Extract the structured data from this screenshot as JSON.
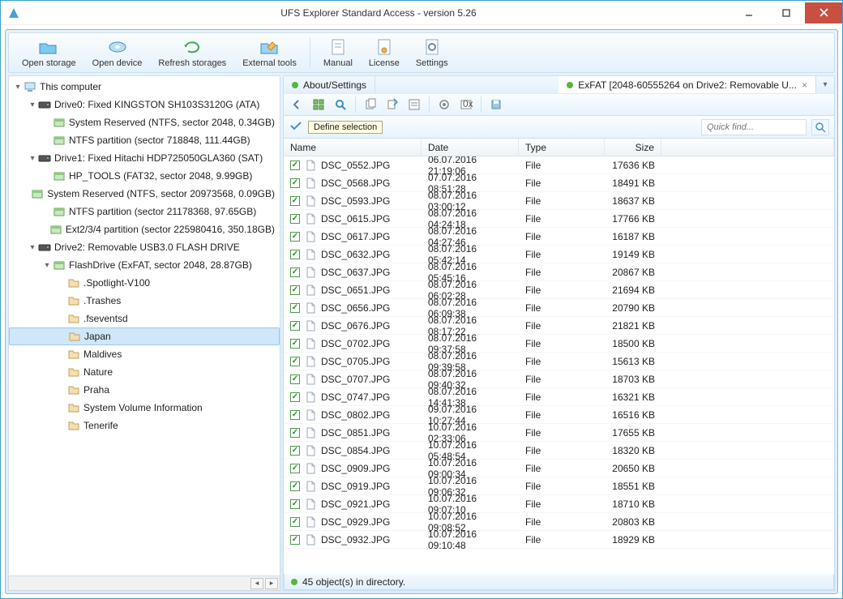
{
  "window": {
    "title": "UFS Explorer Standard Access - version 5.26"
  },
  "toolbar": {
    "open_storage": "Open storage",
    "open_device": "Open device",
    "refresh_storages": "Refresh storages",
    "external_tools": "External tools",
    "manual": "Manual",
    "license": "License",
    "settings": "Settings"
  },
  "tree": {
    "root": "This computer",
    "drives": [
      {
        "label": "Drive0: Fixed KINGSTON SH103S3120G (ATA)",
        "parts": [
          "System Reserved (NTFS, sector 2048, 0.34GB)",
          "NTFS partition (sector 718848, 111.44GB)"
        ]
      },
      {
        "label": "Drive1: Fixed Hitachi HDP725050GLA360 (SAT)",
        "parts": [
          "HP_TOOLS (FAT32, sector 2048, 9.99GB)",
          "System Reserved (NTFS, sector 20973568, 0.09GB)",
          "NTFS partition (sector 21178368, 97.65GB)",
          "Ext2/3/4 partition (sector 225980416, 350.18GB)"
        ]
      },
      {
        "label": "Drive2: Removable USB3.0 FLASH DRIVE",
        "parts": [
          "FlashDrive (ExFAT, sector 2048, 28.87GB)"
        ],
        "folders": [
          ".Spotlight-V100",
          ".Trashes",
          ".fseventsd",
          "Japan",
          "Maldives",
          "Nature",
          "Praha",
          "System Volume Information",
          "Tenerife"
        ],
        "selected_folder": "Japan"
      }
    ]
  },
  "tabs": {
    "about": "About/Settings",
    "exfat": "ExFAT [2048-60555264 on Drive2: Removable U..."
  },
  "define_tooltip": "Define selection",
  "search": {
    "placeholder": "Quick find..."
  },
  "columns": {
    "name": "Name",
    "date": "Date",
    "type": "Type",
    "size": "Size"
  },
  "files": [
    {
      "name": "DSC_0552.JPG",
      "date": "06.07.2016 21:19:06",
      "type": "File",
      "size": "17636 KB"
    },
    {
      "name": "DSC_0568.JPG",
      "date": "07.07.2016 08:51:28",
      "type": "File",
      "size": "18491 KB"
    },
    {
      "name": "DSC_0593.JPG",
      "date": "08.07.2016 03:00:12",
      "type": "File",
      "size": "18637 KB"
    },
    {
      "name": "DSC_0615.JPG",
      "date": "08.07.2016 04:24:18",
      "type": "File",
      "size": "17766 KB"
    },
    {
      "name": "DSC_0617.JPG",
      "date": "08.07.2016 04:27:46",
      "type": "File",
      "size": "16187 KB"
    },
    {
      "name": "DSC_0632.JPG",
      "date": "08.07.2016 05:42:14",
      "type": "File",
      "size": "19149 KB"
    },
    {
      "name": "DSC_0637.JPG",
      "date": "08.07.2016 05:45:16",
      "type": "File",
      "size": "20867 KB"
    },
    {
      "name": "DSC_0651.JPG",
      "date": "08.07.2016 06:02:28",
      "type": "File",
      "size": "21694 KB"
    },
    {
      "name": "DSC_0656.JPG",
      "date": "08.07.2016 06:09:38",
      "type": "File",
      "size": "20790 KB"
    },
    {
      "name": "DSC_0676.JPG",
      "date": "08.07.2016 08:17:22",
      "type": "File",
      "size": "21821 KB"
    },
    {
      "name": "DSC_0702.JPG",
      "date": "08.07.2016 09:37:58",
      "type": "File",
      "size": "18500 KB"
    },
    {
      "name": "DSC_0705.JPG",
      "date": "08.07.2016 09:39:58",
      "type": "File",
      "size": "15613 KB"
    },
    {
      "name": "DSC_0707.JPG",
      "date": "08.07.2016 09:40:32",
      "type": "File",
      "size": "18703 KB"
    },
    {
      "name": "DSC_0747.JPG",
      "date": "08.07.2016 14:41:38",
      "type": "File",
      "size": "16321 KB"
    },
    {
      "name": "DSC_0802.JPG",
      "date": "09.07.2016 10:27:44",
      "type": "File",
      "size": "16516 KB"
    },
    {
      "name": "DSC_0851.JPG",
      "date": "10.07.2016 02:33:06",
      "type": "File",
      "size": "17655 KB"
    },
    {
      "name": "DSC_0854.JPG",
      "date": "10.07.2016 05:48:54",
      "type": "File",
      "size": "18320 KB"
    },
    {
      "name": "DSC_0909.JPG",
      "date": "10.07.2016 09:00:34",
      "type": "File",
      "size": "20650 KB"
    },
    {
      "name": "DSC_0919.JPG",
      "date": "10.07.2016 09:06:32",
      "type": "File",
      "size": "18551 KB"
    },
    {
      "name": "DSC_0921.JPG",
      "date": "10.07.2016 09:07:10",
      "type": "File",
      "size": "18710 KB"
    },
    {
      "name": "DSC_0929.JPG",
      "date": "10.07.2016 09:08:52",
      "type": "File",
      "size": "20803 KB"
    },
    {
      "name": "DSC_0932.JPG",
      "date": "10.07.2016 09:10:48",
      "type": "File",
      "size": "18929 KB"
    }
  ],
  "status": "45 object(s) in directory."
}
